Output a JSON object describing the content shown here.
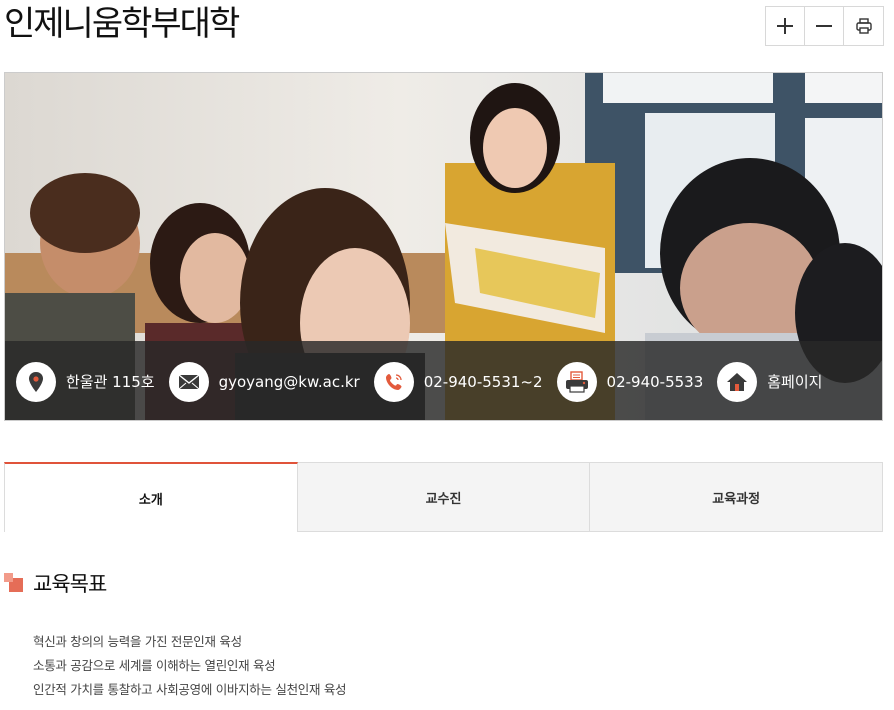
{
  "page": {
    "title": "인제니움학부대학"
  },
  "toolbar": {
    "zoom_in_icon": "plus-icon",
    "zoom_out_icon": "minus-icon",
    "print_icon": "printer-icon"
  },
  "info": {
    "location": "한울관 115호",
    "email": "gyoyang@kw.ac.kr",
    "phone": "02-940-5531~2",
    "fax": "02-940-5533",
    "homepage": "홈페이지"
  },
  "tabs": [
    {
      "label": "소개",
      "active": true
    },
    {
      "label": "교수진",
      "active": false
    },
    {
      "label": "교육과정",
      "active": false
    }
  ],
  "section": {
    "title": "교육목표",
    "goals": [
      "혁신과 창의의 능력을 가진 전문인재 육성",
      "소통과 공감으로 세계를 이해하는 열린인재 육성",
      "인간적 가치를 통찰하고 사회공영에 이바지하는 실천인재 육성"
    ]
  },
  "colors": {
    "accent": "#e0533a",
    "icon_accent": "#e35a3c",
    "bar_bg": "#282828"
  }
}
